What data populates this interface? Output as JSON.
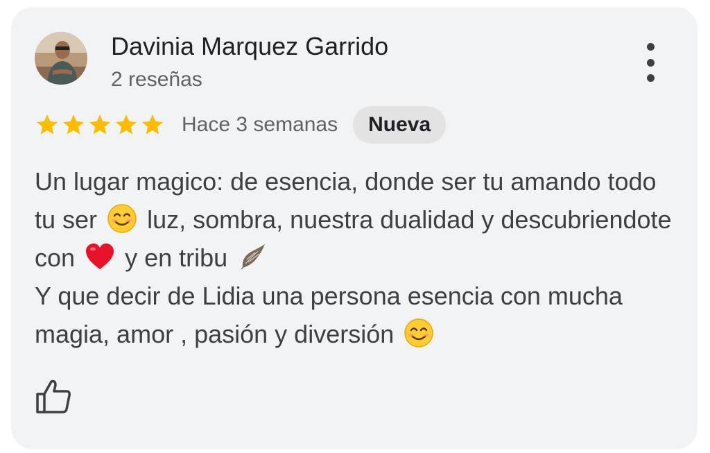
{
  "review": {
    "author": "Davinia Marquez Garrido",
    "reviews_count": "2 reseñas",
    "rating": 5,
    "rating_max": 5,
    "time_ago": "Hace 3 semanas",
    "badge": "Nueva",
    "text": {
      "segment1": "Un lugar magico: de esencia, donde ser tu amando todo tu ser",
      "emoji1": "smiling-face",
      "segment2": "luz, sombra, nuestra dualidad y descubriendote con",
      "emoji2": "red-heart",
      "segment3": "y en tribu",
      "emoji3": "feather",
      "segment4": "Y que decir de Lidia una persona esencia con mucha magia, amor , pasión y diversión",
      "emoji4": "smiling-face"
    }
  },
  "colors": {
    "card_background": "#f1f3f4",
    "star": "#fbbc04",
    "badge_background": "#e3e3e3"
  },
  "icons": {
    "menu": "more-vert-icon",
    "like": "thumb-up-icon"
  }
}
